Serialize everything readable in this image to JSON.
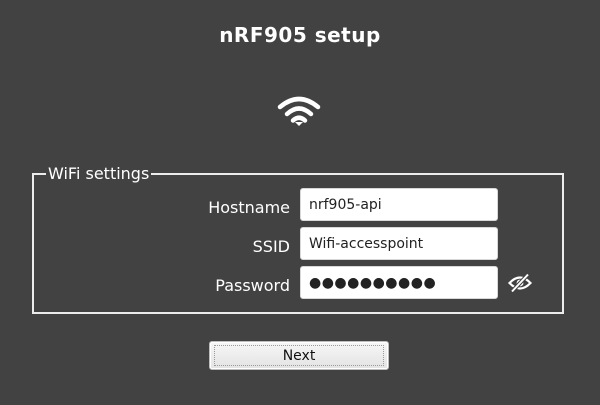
{
  "page": {
    "title": "nRF905 setup",
    "logo_icon": "wifi-icon"
  },
  "wifi_settings": {
    "legend": "WiFi settings",
    "hostname": {
      "label": "Hostname",
      "value": "nrf905-api"
    },
    "ssid": {
      "label": "SSID",
      "value": "Wifi-accesspoint"
    },
    "password": {
      "label": "Password",
      "value": "●●●●●●●●●●",
      "toggle_icon": "eye-slash-icon"
    }
  },
  "actions": {
    "next_label": "Next"
  },
  "colors": {
    "background": "#424242",
    "text": "#ffffff",
    "field_background": "#ffffff",
    "button_background": "#ececec"
  }
}
